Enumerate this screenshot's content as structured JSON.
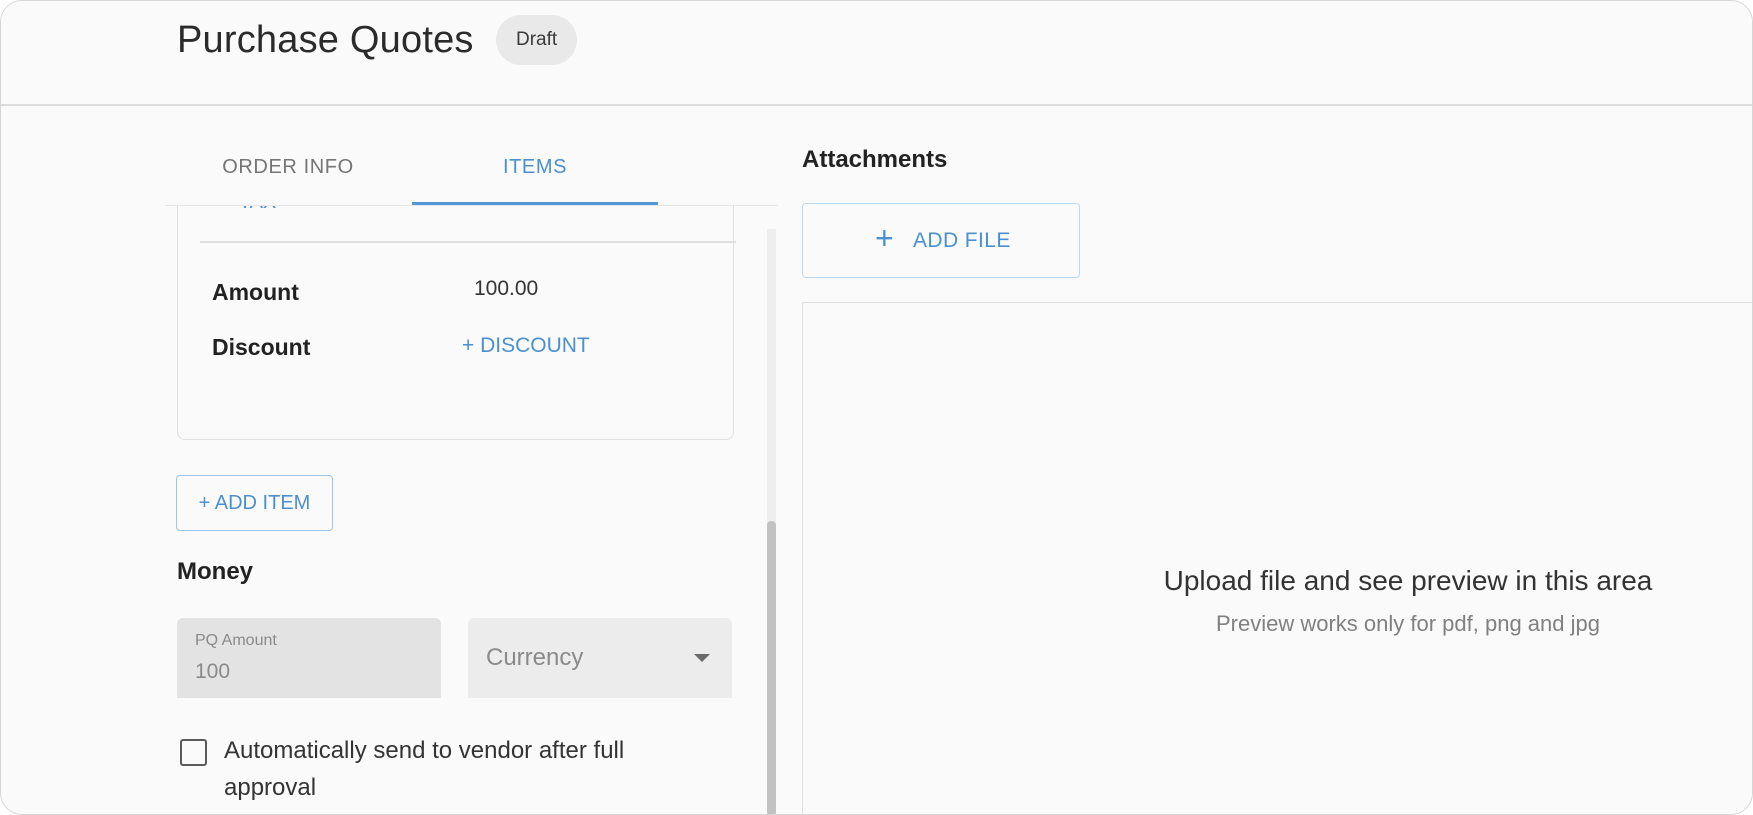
{
  "header": {
    "title": "Purchase Quotes",
    "status": "Draft"
  },
  "tabs": [
    {
      "label": "ORDER INFO",
      "active": false
    },
    {
      "label": "ITEMS",
      "active": true
    }
  ],
  "item_card": {
    "tax_link": "+ TAX",
    "amount_label": "Amount",
    "amount_value": "100.00",
    "discount_label": "Discount",
    "discount_link": "+ DISCOUNT"
  },
  "add_item_label": "+ ADD ITEM",
  "money": {
    "title": "Money",
    "pq_amount_label": "PQ Amount",
    "pq_amount_value": "100",
    "currency_placeholder": "Currency"
  },
  "auto_send": {
    "label": "Automatically send to vendor after full approval",
    "checked": false
  },
  "attachments": {
    "title": "Attachments",
    "add_file_label": "ADD FILE",
    "preview_title": "Upload file and see preview in this area",
    "preview_subtitle": "Preview works only for pdf, png and jpg"
  },
  "colors": {
    "accent": "#4a90d0",
    "badge_bg": "#e9e9e9",
    "disabled_field": "#e3e3e3"
  }
}
